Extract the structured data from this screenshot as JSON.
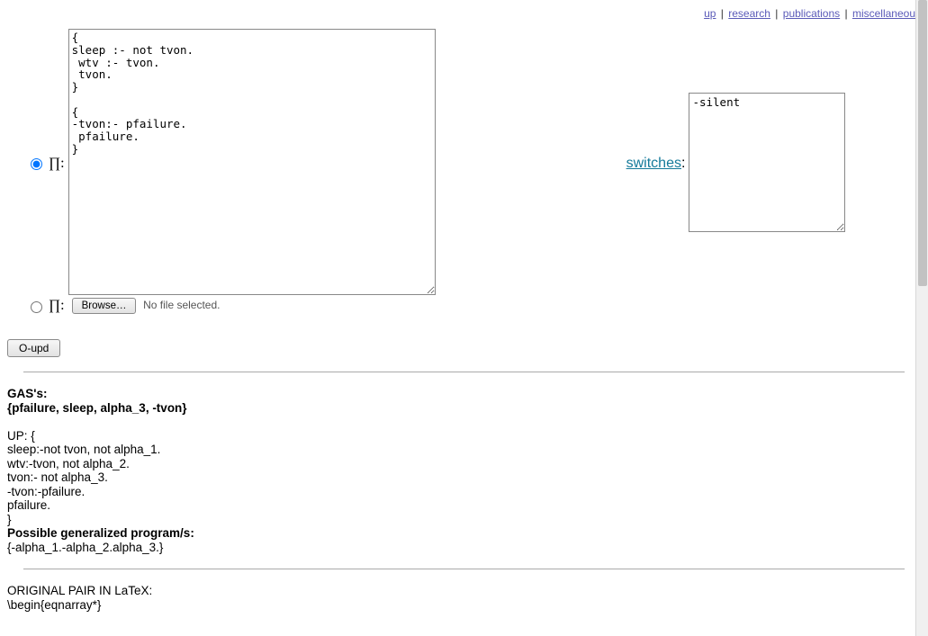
{
  "topnav": {
    "up": "up",
    "research": "research",
    "publications": "publications",
    "miscellaneous": "miscellaneous"
  },
  "form": {
    "pi_label1": "∏:",
    "pi_label2": "∏:",
    "main_textarea": "{\nsleep :- not tvon.\n wtv :- tvon.\n tvon.\n}\n\n{\n-tvon:- pfailure.\n pfailure.\n}",
    "switches_label": "switches",
    "switches_textarea": "-silent",
    "browse_label": "Browse…",
    "nofile": "No file selected.",
    "submit_label": "O-upd"
  },
  "output": {
    "gas_heading": "GAS's:",
    "gas_line": "{pfailure, sleep, alpha_3, -tvon}",
    "up_heading": "UP: {",
    "up_lines": [
      "sleep:-not tvon, not alpha_1.",
      "wtv:-tvon, not alpha_2.",
      "tvon:- not alpha_3.",
      "-tvon:-pfailure.",
      "pfailure.",
      "}"
    ],
    "pgp_heading": "Possible generalized program/s:",
    "pgp_line": "{-alpha_1.-alpha_2.alpha_3.}",
    "latex_heading": "ORIGINAL PAIR IN LaTeX:",
    "latex_line1": "\\begin{eqnarray*}"
  }
}
